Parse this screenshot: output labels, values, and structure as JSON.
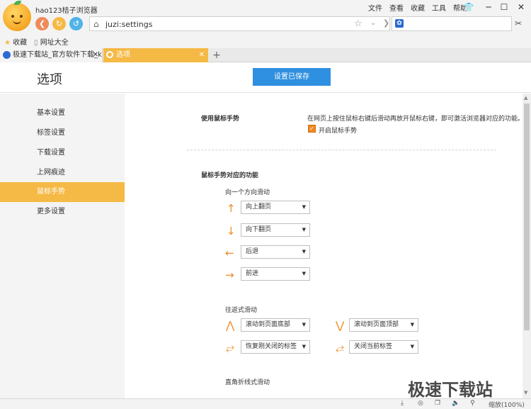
{
  "window": {
    "title": "hao123桔子浏览器",
    "menu": [
      "文件",
      "查看",
      "收藏",
      "工具",
      "帮助"
    ]
  },
  "address": {
    "url": "juzi:settings",
    "search_value": ""
  },
  "favorites": [
    {
      "label": "收藏",
      "icon": "star-icon"
    },
    {
      "label": "网址大全",
      "icon": "page-icon"
    }
  ],
  "tabs": [
    {
      "label": "极速下载站_官方软件下载_k",
      "active": false
    },
    {
      "label": "选项",
      "active": true
    }
  ],
  "page": {
    "title": "选项",
    "save_button": "设置已保存"
  },
  "sidebar": {
    "items": [
      {
        "label": "基本设置",
        "active": false
      },
      {
        "label": "标签设置",
        "active": false
      },
      {
        "label": "下载设置",
        "active": false
      },
      {
        "label": "上网痕迹",
        "active": false
      },
      {
        "label": "鼠标手势",
        "active": true
      },
      {
        "label": "更多设置",
        "active": false
      }
    ]
  },
  "gesture": {
    "section_label": "使用鼠标手势",
    "description": "在网页上按住鼠标右键后滑动再放开鼠标右键，即可激活浏览器对应的功能。",
    "enable_label": "开启鼠标手势",
    "enabled": true,
    "functions_title": "鼠标手势对应的功能",
    "one_direction_title": "向一个方向滑动",
    "one_direction": [
      {
        "icon": "arrow-up-icon",
        "glyph": "↑",
        "value": "向上翻页"
      },
      {
        "icon": "arrow-down-icon",
        "glyph": "↓",
        "value": "向下翻页"
      },
      {
        "icon": "arrow-left-icon",
        "glyph": "←",
        "value": "后退"
      },
      {
        "icon": "arrow-right-icon",
        "glyph": "→",
        "value": "前进"
      }
    ],
    "roundtrip_title": "往返式滑动",
    "roundtrip": [
      {
        "icon": "down-up-icon",
        "glyph": "⋀",
        "value": "滚动到页面底部"
      },
      {
        "icon": "up-down-icon",
        "glyph": "⋁",
        "value": "滚动到页面顶部"
      },
      {
        "icon": "left-right-icon",
        "glyph": "⥂",
        "value": "恢复刚关闭的标签"
      },
      {
        "icon": "right-left-icon",
        "glyph": "⥄",
        "value": "关闭当前标签"
      }
    ],
    "corner_title": "直角折线式滑动"
  },
  "statusbar": {
    "zoom": "缩放(100%)"
  },
  "watermark": "极速下载站",
  "colors": {
    "accent": "#f5b945",
    "primary": "#2f8fe0",
    "icon": "#f08a24"
  }
}
